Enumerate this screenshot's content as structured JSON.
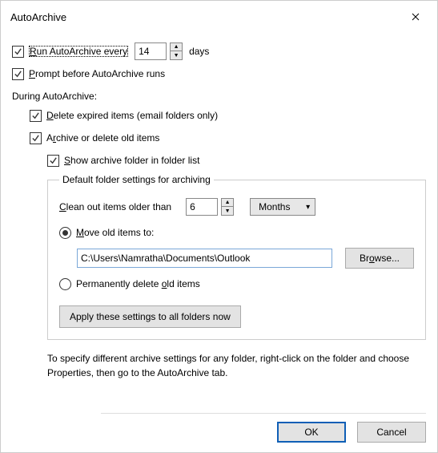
{
  "window": {
    "title": "AutoArchive"
  },
  "run": {
    "label_pre": "R",
    "label_post": "un AutoArchive every",
    "value": "14",
    "unit": "days",
    "checked": true
  },
  "prompt": {
    "label_u": "P",
    "label_post": "rompt before AutoArchive runs",
    "checked": true
  },
  "during_heading": "During AutoArchive:",
  "delete_expired": {
    "label_u": "D",
    "label_post": "elete expired items (email folders only)",
    "checked": true
  },
  "archive_old": {
    "label_pre": "A",
    "label_u": "r",
    "label_post": "chive or delete old items",
    "checked": true
  },
  "show_folder": {
    "label_u": "S",
    "label_post": "how archive folder in folder list",
    "checked": true
  },
  "fieldset_legend": "Default folder settings for archiving",
  "clean": {
    "label_u": "C",
    "label_post": "lean out items older than",
    "value": "6",
    "unit_selected": "Months"
  },
  "move": {
    "label_u": "M",
    "label_post": "ove old items to:",
    "selected": true,
    "path": "C:\\Users\\Namratha\\Documents\\Outlook"
  },
  "browse": {
    "label_pre": "Br",
    "label_u": "o",
    "label_post": "wse..."
  },
  "perm_delete": {
    "label_pre": "Permanently delete ",
    "label_u": "o",
    "label_post": "ld items",
    "selected": false
  },
  "apply_label": "Apply these settings to all folders now",
  "helptext": "To specify different archive settings for any folder, right-click on the folder and choose Properties, then go to the AutoArchive tab.",
  "buttons": {
    "ok": "OK",
    "cancel": "Cancel"
  }
}
